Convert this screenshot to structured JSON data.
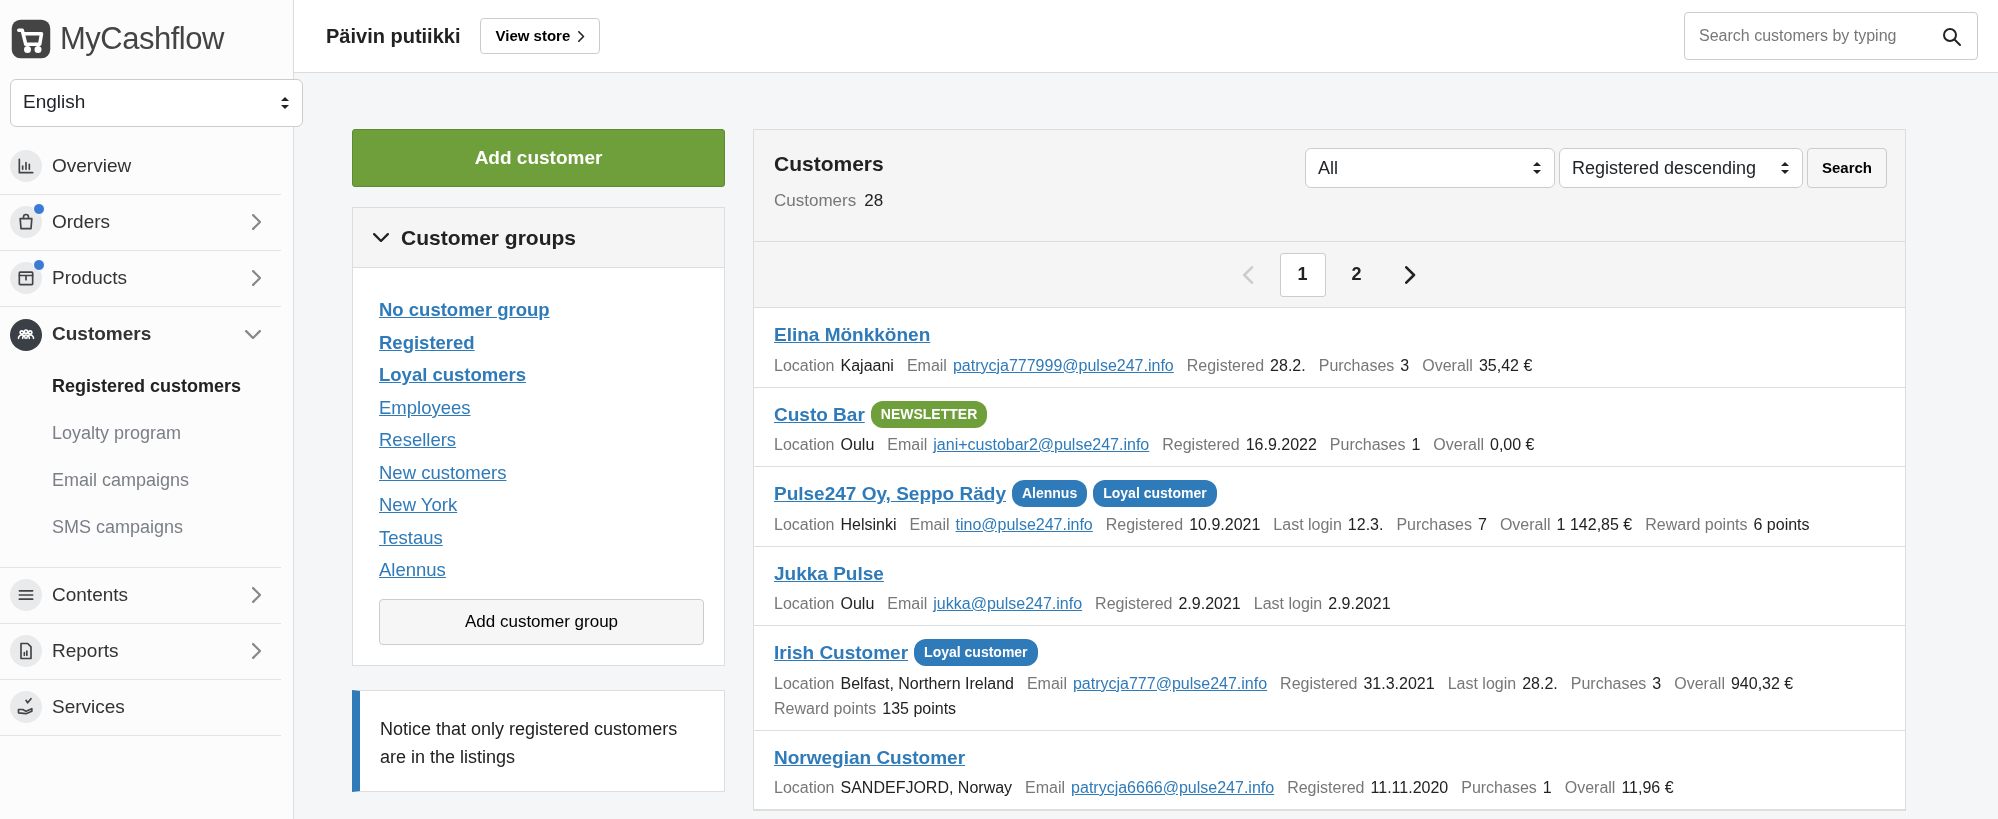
{
  "brand": {
    "name": "MyCashflow"
  },
  "language_select": {
    "value": "English"
  },
  "sidebar": {
    "items": [
      {
        "label": "Overview",
        "selected": false,
        "notification": false,
        "expandable": false
      },
      {
        "label": "Orders",
        "selected": false,
        "notification": true,
        "expandable": true,
        "expanded": false
      },
      {
        "label": "Products",
        "selected": false,
        "notification": true,
        "expandable": true,
        "expanded": false
      },
      {
        "label": "Customers",
        "selected": true,
        "notification": false,
        "expandable": true,
        "expanded": true,
        "children": [
          {
            "label": "Registered customers",
            "selected": true
          },
          {
            "label": "Loyalty program",
            "selected": false
          },
          {
            "label": "Email campaigns",
            "selected": false
          },
          {
            "label": "SMS campaigns",
            "selected": false
          }
        ]
      },
      {
        "label": "Contents",
        "selected": false,
        "notification": false,
        "expandable": true,
        "expanded": false
      },
      {
        "label": "Reports",
        "selected": false,
        "notification": false,
        "expandable": true,
        "expanded": false
      },
      {
        "label": "Services",
        "selected": false,
        "notification": false,
        "expandable": false
      }
    ]
  },
  "header": {
    "store_name": "Päivin putiikki",
    "view_store_button": "View store",
    "search": {
      "placeholder": "Search customers by typing"
    }
  },
  "add_customer_button": "Add customer",
  "customer_groups": {
    "title": "Customer groups",
    "expanded": true,
    "groups": [
      {
        "label": "No customer group",
        "highlighted": true
      },
      {
        "label": "Registered",
        "highlighted": true
      },
      {
        "label": "Loyal customers",
        "highlighted": true
      },
      {
        "label": "Employees",
        "highlighted": false
      },
      {
        "label": "Resellers",
        "highlighted": false
      },
      {
        "label": "New customers",
        "highlighted": false
      },
      {
        "label": "New York",
        "highlighted": false
      },
      {
        "label": "Testaus",
        "highlighted": false
      },
      {
        "label": "Alennus",
        "highlighted": false
      }
    ],
    "add_group_button": "Add customer group"
  },
  "notice": "Notice that only registered customers are in the listings",
  "customers_panel": {
    "title": "Customers",
    "count_label": "Customers",
    "count": "28",
    "filter_select": "All",
    "sort_select": "Registered descending",
    "search_button": "Search",
    "pagination": {
      "prev_disabled": true,
      "pages": [
        {
          "label": "1",
          "selected": true
        },
        {
          "label": "2",
          "selected": false
        }
      ]
    },
    "customers": [
      {
        "name": "Elina Mönkkönen",
        "fields": [
          {
            "label": "Location",
            "value": "Kajaani",
            "kind": "text"
          },
          {
            "label": "Email",
            "value": "patrycja777999@pulse247.info",
            "kind": "link"
          },
          {
            "label": "Registered",
            "value": "28.2.",
            "kind": "text"
          },
          {
            "label": "Purchases",
            "value": "3",
            "kind": "text"
          },
          {
            "label": "Overall",
            "value": "35,42 €",
            "kind": "text"
          }
        ]
      },
      {
        "name": "Custo Bar",
        "tags": [
          {
            "label": "NEWSLETTER",
            "color": "#6e9f3a"
          }
        ],
        "fields": [
          {
            "label": "Location",
            "value": "Oulu",
            "kind": "text"
          },
          {
            "label": "Email",
            "value": "jani+custobar2@pulse247.info",
            "kind": "link"
          },
          {
            "label": "Registered",
            "value": "16.9.2022",
            "kind": "text"
          },
          {
            "label": "Purchases",
            "value": "1",
            "kind": "text"
          },
          {
            "label": "Overall",
            "value": "0,00 €",
            "kind": "text"
          }
        ]
      },
      {
        "name": "Pulse247 Oy, Seppo Rädy",
        "tags": [
          {
            "label": "Alennus",
            "color": "#2f7ab8"
          },
          {
            "label": "Loyal customer",
            "color": "#2f7ab8"
          }
        ],
        "fields": [
          {
            "label": "Location",
            "value": "Helsinki",
            "kind": "text"
          },
          {
            "label": "Email",
            "value": "tino@pulse247.info",
            "kind": "link"
          },
          {
            "label": "Registered",
            "value": "10.9.2021",
            "kind": "text"
          },
          {
            "label": "Last login",
            "value": "12.3.",
            "kind": "text"
          },
          {
            "label": "Purchases",
            "value": "7",
            "kind": "text"
          },
          {
            "label": "Overall",
            "value": "1 142,85 €",
            "kind": "text"
          },
          {
            "label": "Reward points",
            "value": "6 points",
            "kind": "text"
          }
        ]
      },
      {
        "name": "Jukka Pulse",
        "fields": [
          {
            "label": "Location",
            "value": "Oulu",
            "kind": "text"
          },
          {
            "label": "Email",
            "value": "jukka@pulse247.info",
            "kind": "link"
          },
          {
            "label": "Registered",
            "value": "2.9.2021",
            "kind": "text"
          },
          {
            "label": "Last login",
            "value": "2.9.2021",
            "kind": "text"
          }
        ]
      },
      {
        "name": "Irish Customer",
        "tags": [
          {
            "label": "Loyal customer",
            "color": "#2f7ab8"
          }
        ],
        "fields": [
          {
            "label": "Location",
            "value": "Belfast, Northern Ireland",
            "kind": "text"
          },
          {
            "label": "Email",
            "value": "patrycja777@pulse247.info",
            "kind": "link"
          },
          {
            "label": "Registered",
            "value": "31.3.2021",
            "kind": "text"
          },
          {
            "label": "Last login",
            "value": "28.2.",
            "kind": "text"
          },
          {
            "label": "Purchases",
            "value": "3",
            "kind": "text"
          },
          {
            "label": "Overall",
            "value": "940,32 €",
            "kind": "text"
          },
          {
            "label": "Reward points",
            "value": "135 points",
            "kind": "text"
          }
        ]
      },
      {
        "name": "Norwegian Customer",
        "fields": [
          {
            "label": "Location",
            "value": "SANDEFJORD, Norway",
            "kind": "text"
          },
          {
            "label": "Email",
            "value": "patrycja6666@pulse247.info",
            "kind": "link"
          },
          {
            "label": "Registered",
            "value": "11.11.2020",
            "kind": "text"
          },
          {
            "label": "Purchases",
            "value": "1",
            "kind": "text"
          },
          {
            "label": "Overall",
            "value": "11,96 €",
            "kind": "text"
          }
        ]
      }
    ]
  }
}
